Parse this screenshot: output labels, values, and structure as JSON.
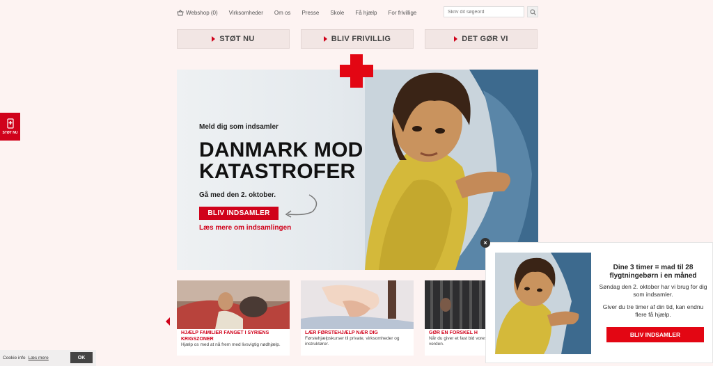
{
  "topnav": {
    "webshop": "Webshop (0)",
    "items": [
      "Virksomheder",
      "Om os",
      "Presse",
      "Skole",
      "Få hjælp",
      "For frivillige"
    ]
  },
  "search": {
    "placeholder": "Skriv dit søgeord"
  },
  "main_buttons": [
    "STØT NU",
    "BLIV FRIVILLIG",
    "DET GØR VI"
  ],
  "side_tab": {
    "label": "STØT NU"
  },
  "hero": {
    "kicker": "Meld dig som indsamler",
    "title_line1": "DANMARK MOD",
    "title_line2": "KATASTROFER",
    "subtitle": "Gå med den 2. oktober.",
    "cta": "BLIV INDSAMLER",
    "link": "Læs mere om indsamlingen"
  },
  "cards": [
    {
      "title": "HJÆLP FAMILIER FANGET I SYRIENS KRIGSZONER",
      "text": "Hjælp os med at nå frem med livsvigtig nødhjælp."
    },
    {
      "title": "LÆR FØRSTEHJÆLP NÆR DIG",
      "text": "Førstehjælpskurser til private, virksomheder og instruktører."
    },
    {
      "title": "GØR EN FORSKEL H",
      "text": "Når du giver et fast bid vores hjælpearbejde i D verden."
    }
  ],
  "popup": {
    "close": "×",
    "title": "Dine 3 timer = mad til 28 flygtningebørn i en måned",
    "p1": "Søndag den 2. oktober har vi brug for dig som indsamler.",
    "p2": "Giver du tre timer af din tid, kan endnu flere få hjælp.",
    "cta": "BLIV INDSAMLER"
  },
  "cookie": {
    "text": "Cookie info",
    "link": "Læs mere",
    "ok": "OK"
  },
  "colors": {
    "brand_red": "#e30613",
    "cta_red": "#d0021b",
    "background": "#fdf3f2"
  },
  "icons": [
    "basket-icon",
    "search-icon",
    "red-cross-logo",
    "phone-icon",
    "close-icon",
    "chevron-left-icon",
    "curved-arrow-icon"
  ]
}
